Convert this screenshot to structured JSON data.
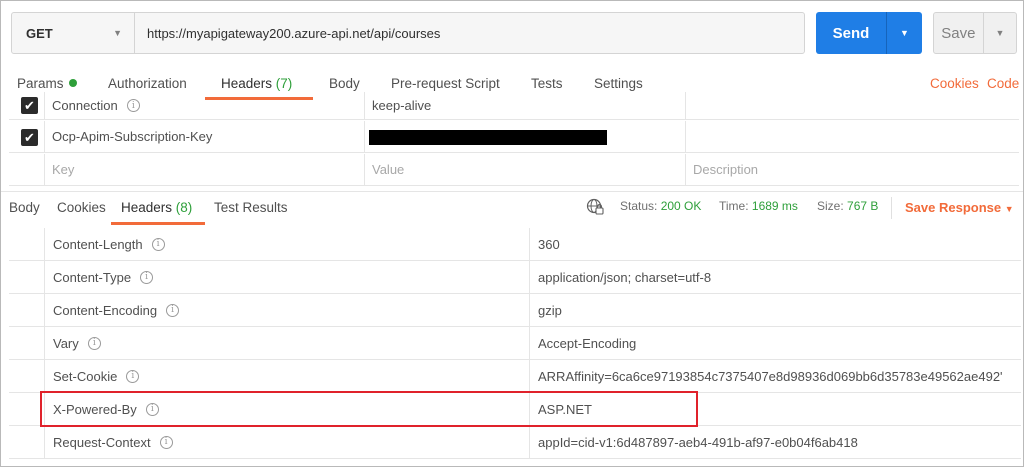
{
  "request": {
    "method": "GET",
    "url": "https://myapigateway200.azure-api.net/api/courses",
    "send_label": "Send",
    "save_label": "Save"
  },
  "request_tabs": {
    "params": "Params",
    "authorization": "Authorization",
    "headers": "Headers",
    "headers_count": "(7)",
    "body": "Body",
    "prerequest": "Pre-request Script",
    "tests": "Tests",
    "settings": "Settings",
    "cookies": "Cookies",
    "code": "Code"
  },
  "request_headers": [
    {
      "key": "Connection",
      "value": "keep-alive",
      "checked": true
    },
    {
      "key": "Ocp-Apim-Subscription-Key",
      "value": "",
      "checked": true
    }
  ],
  "request_placeholders": {
    "key": "Key",
    "value": "Value",
    "description": "Description"
  },
  "response_tabs": {
    "body": "Body",
    "cookies": "Cookies",
    "headers": "Headers",
    "headers_count": "(8)",
    "test_results": "Test Results"
  },
  "response_status": {
    "status_label": "Status:",
    "status_value": "200 OK",
    "time_label": "Time:",
    "time_value": "1689 ms",
    "size_label": "Size:",
    "size_value": "767 B",
    "save_response": "Save Response"
  },
  "response_headers": [
    {
      "key": "Content-Length",
      "value": "360"
    },
    {
      "key": "Content-Type",
      "value": "application/json; charset=utf-8"
    },
    {
      "key": "Content-Encoding",
      "value": "gzip"
    },
    {
      "key": "Vary",
      "value": "Accept-Encoding"
    },
    {
      "key": "Set-Cookie",
      "value": "ARRAffinity=6ca6ce97193854c7375407e8d98936d069bb6d35783e49562ae492'"
    },
    {
      "key": "X-Powered-By",
      "value": "ASP.NET"
    },
    {
      "key": "Request-Context",
      "value": "appId=cid-v1:6d487897-aeb4-491b-af97-e0b04f6ab418"
    }
  ],
  "colors": {
    "accent": "#f26b3a",
    "send": "#1f7ee6",
    "success": "#2e9f3a",
    "highlight": "#e0222b"
  }
}
